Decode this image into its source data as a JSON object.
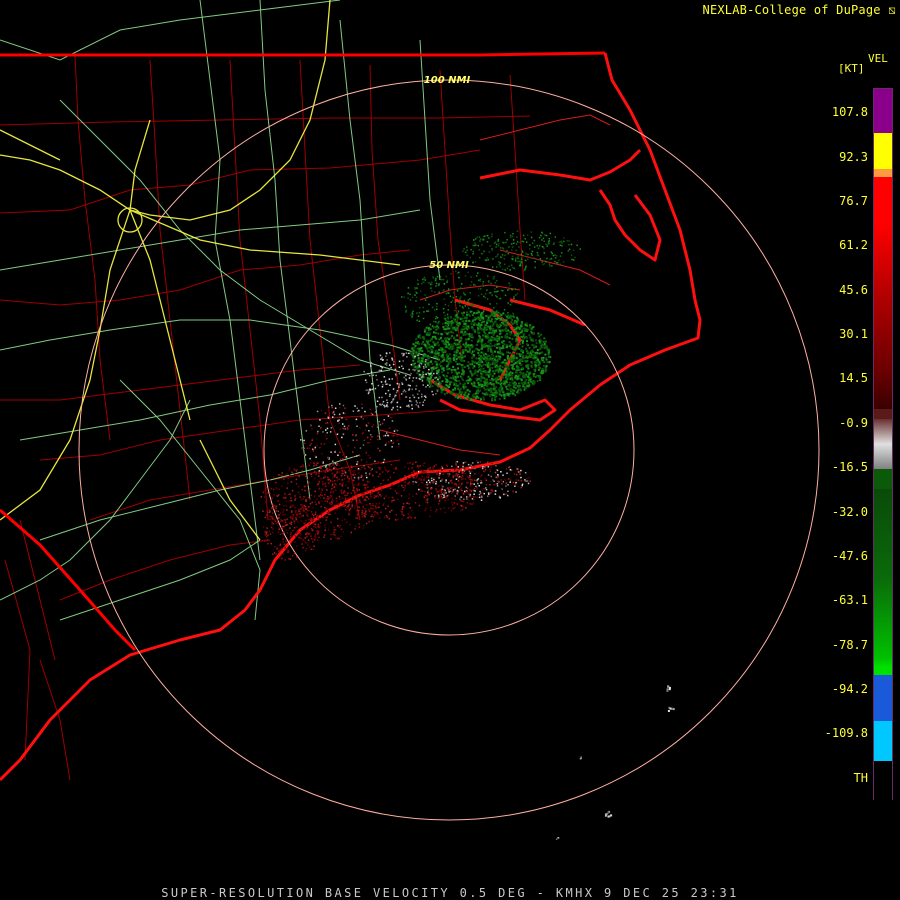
{
  "header": {
    "credit": "NEXLAB-College of DuPage"
  },
  "legend": {
    "product": "VEL",
    "unit": "[KT]",
    "ticks": [
      "107.8",
      "92.3",
      "76.7",
      "61.2",
      "45.6",
      "30.1",
      "14.5",
      "-0.9",
      "-16.5",
      "-32.0",
      "-47.6",
      "-63.1",
      "-78.7",
      "-94.2",
      "-109.8",
      "TH"
    ],
    "colors": {
      "purple": "#8a008a",
      "yellow": "#ffff00",
      "orange": "#ff9a40",
      "red": "#ff0000",
      "darkred": "#7a0000",
      "gray": "#bdbdbd",
      "darkgreen": "#0a5a0a",
      "green": "#00e000",
      "blue": "#1a5ad8",
      "cyan": "#00c8ff"
    }
  },
  "map": {
    "range_rings": [
      "100 NMI",
      "50 NMI"
    ],
    "colors": {
      "state_border": "#ff0000",
      "county_lines": "#b00000",
      "highways_major": "#ffff44",
      "highways_minor": "#99ee99",
      "rings": "#ffb0a0"
    }
  },
  "footer": {
    "title": "SUPER-RESOLUTION BASE VELOCITY 0.5 DEG - KMHX 9 DEC 25 23:31"
  }
}
